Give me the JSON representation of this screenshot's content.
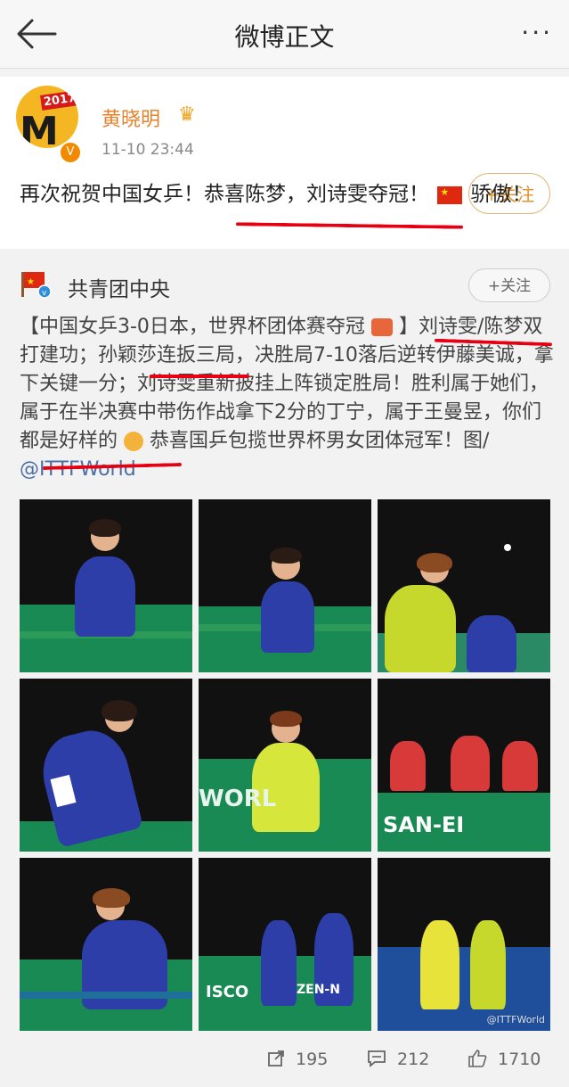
{
  "header": {
    "title": "微博正文",
    "more": "···"
  },
  "post": {
    "author": "黄晓明",
    "avatar_badge": "2017",
    "time": "11-10 23:44",
    "follow": "+关注",
    "text_a": "再次祝贺中国女乒！恭喜陈梦，刘诗雯夺冠！",
    "text_b": "骄傲！"
  },
  "repost": {
    "author": "共青团中央",
    "follow": "+关注",
    "text_1": "【中国女乒3-0日本，世界杯团体赛夺冠",
    "text_2": "】刘诗雯/陈梦双打建功；孙颖莎连扳三局，决胜局7-10落后逆转伊藤美诚，拿下关键一分；刘诗雯重新披挂上阵锁定胜局！胜利属于她们，属于在半决赛中带伤作战拿下2分的丁宁，属于王曼昱，你们都是好样的",
    "text_3": "恭喜国乒包揽世界杯男女团体冠军！图/",
    "mention": "@ITTFWorld"
  },
  "photos": [
    {
      "name": "photo-1",
      "text": ""
    },
    {
      "name": "photo-2",
      "text": ""
    },
    {
      "name": "photo-3",
      "text": ""
    },
    {
      "name": "photo-4",
      "text": ""
    },
    {
      "name": "photo-5",
      "text": "WORL"
    },
    {
      "name": "photo-6",
      "text": "SAN-EI"
    },
    {
      "name": "photo-7",
      "text": "ISCO"
    },
    {
      "name": "photo-8",
      "text": "ZEN-N"
    },
    {
      "name": "photo-9",
      "text": "@ITTFWorld"
    }
  ],
  "actions": {
    "reposts": "195",
    "comments": "212",
    "likes": "1710"
  },
  "colors": {
    "orange": "#e7822b",
    "annotation": "#e60012",
    "link": "#4a6fa5"
  }
}
